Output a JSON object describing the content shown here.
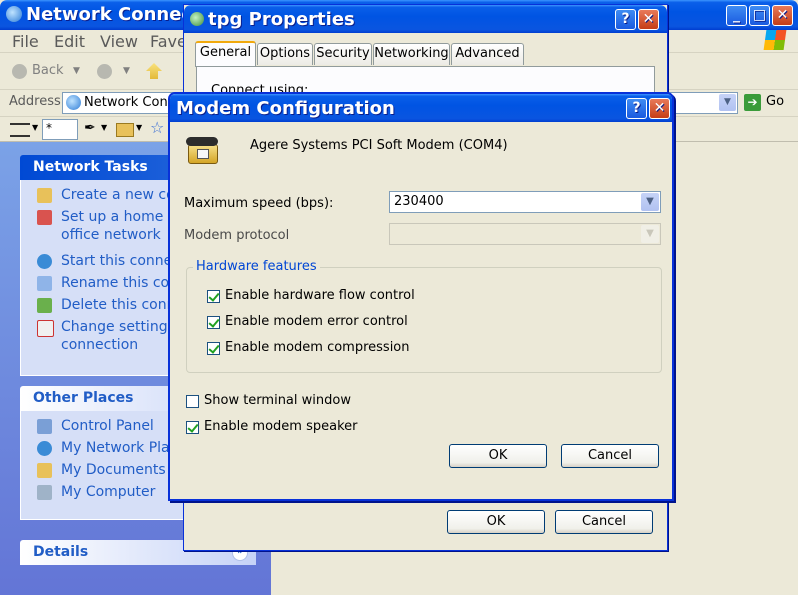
{
  "explorer": {
    "title": "Network Connect",
    "menu": [
      "File",
      "Edit",
      "View",
      "Fave"
    ],
    "back_label": "Back",
    "address_label": "Address",
    "address_value": "Network Conn",
    "go_label": "Go",
    "link_field_value": "*",
    "network_tasks": {
      "title": "Network Tasks",
      "items": [
        "Create a new con",
        "Set up a home or",
        "office network",
        "Start this connec",
        "Rename this conn",
        "Delete this conne",
        "Change settings o",
        "connection"
      ]
    },
    "other_places": {
      "title": "Other Places",
      "items": [
        "Control Panel",
        "My Network Place",
        "My Documents",
        "My Computer"
      ]
    },
    "details": {
      "title": "Details"
    }
  },
  "properties": {
    "title": "tpg Properties",
    "tabs": [
      "General",
      "Options",
      "Security",
      "Networking",
      "Advanced"
    ],
    "connect_using": "Connect using:",
    "ok": "OK",
    "cancel": "Cancel"
  },
  "modem": {
    "title": "Modem Configuration",
    "device": "Agere Systems PCI Soft Modem (COM4)",
    "max_speed_label": "Maximum speed (bps):",
    "max_speed_value": "230400",
    "protocol_label": "Modem protocol",
    "protocol_value": "",
    "hardware_features": "Hardware features",
    "flow_control": "Enable hardware flow control",
    "error_control": "Enable modem error control",
    "compression": "Enable modem compression",
    "terminal_window": "Show terminal window",
    "speaker": "Enable modem speaker",
    "ok": "OK",
    "cancel": "Cancel"
  }
}
